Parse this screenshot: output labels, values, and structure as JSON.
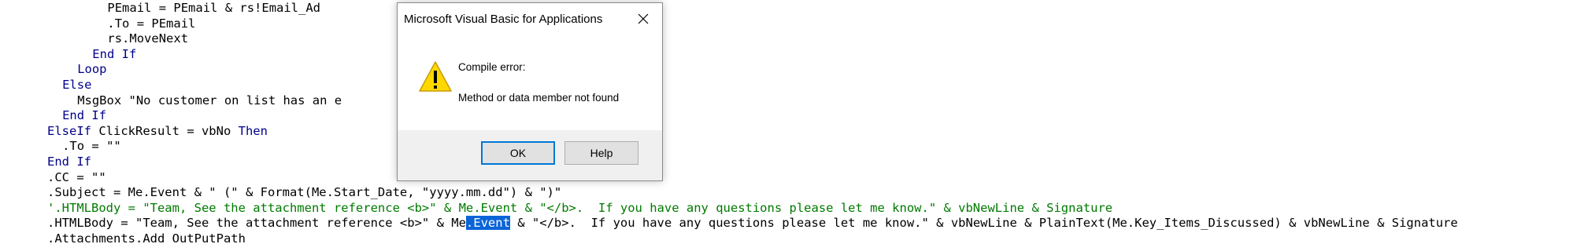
{
  "code_lines": [
    {
      "indent": "                ",
      "segments": [
        {
          "text": "PEmail = PEmail & rs!Email_Ad                  \"",
          "cls": ""
        }
      ]
    },
    {
      "indent": "                ",
      "segments": [
        {
          "text": ".To = PEmail",
          "cls": ""
        }
      ]
    },
    {
      "indent": "                ",
      "segments": [
        {
          "text": "rs.MoveNext",
          "cls": ""
        }
      ]
    },
    {
      "indent": "            ",
      "segments": [
        {
          "text": "End If",
          "cls": "kw"
        }
      ]
    },
    {
      "indent": "        ",
      "segments": [
        {
          "text": "Loop",
          "cls": "kw"
        }
      ]
    },
    {
      "indent": "    ",
      "segments": [
        {
          "text": "Else",
          "cls": "kw"
        }
      ]
    },
    {
      "indent": "        ",
      "segments": [
        {
          "text": "MsgBox \"No customer on list has an e",
          "cls": ""
        }
      ]
    },
    {
      "indent": "    ",
      "segments": [
        {
          "text": "End If",
          "cls": "kw"
        }
      ]
    },
    {
      "indent": "",
      "segments": [
        {
          "text": "ElseIf",
          "cls": "kw"
        },
        {
          "text": " ClickResult = vbNo ",
          "cls": ""
        },
        {
          "text": "Then",
          "cls": "kw"
        }
      ]
    },
    {
      "indent": "    ",
      "segments": [
        {
          "text": ".To = \"\"",
          "cls": ""
        }
      ]
    },
    {
      "indent": "",
      "segments": [
        {
          "text": "End If",
          "cls": "kw"
        }
      ]
    },
    {
      "indent": "",
      "segments": [
        {
          "text": ".CC = \"\"",
          "cls": ""
        }
      ]
    },
    {
      "indent": "",
      "segments": [
        {
          "text": ".Subject = Me.Event & \" (\" & Format(Me.Start_Date, \"yyyy.mm.dd\") & \")\"",
          "cls": ""
        }
      ]
    },
    {
      "indent": "",
      "segments": [
        {
          "text": "'.HTMLBody = \"Team, See the attachment reference <b>\" & Me.Event & \"</b>.  If you have any questions please let me know.\" & vbNewLine & Signature",
          "cls": "cm"
        }
      ]
    },
    {
      "indent": "",
      "segments": [
        {
          "text": ".HTMLBody = \"Team, See the attachment reference <b>\" & Me",
          "cls": ""
        },
        {
          "text": ".Event",
          "cls": "sel"
        },
        {
          "text": " & \"</b>.  If you have any questions please let me know.\" & vbNewLine & PlainText(Me.Key_Items_Discussed) & vbNewLine & Signature",
          "cls": ""
        }
      ]
    },
    {
      "indent": "",
      "segments": [
        {
          "text": ".Attachments.Add OutPutPath",
          "cls": ""
        }
      ]
    }
  ],
  "colors": {
    "keyword": "#00008b",
    "comment": "#007a00",
    "selection": "#0a64d8"
  },
  "dialog": {
    "title": "Microsoft Visual Basic for Applications",
    "close_icon": "close-icon",
    "warning_icon": "warning-icon",
    "message_heading": "Compile error:",
    "message_detail": "Method or data member not found",
    "ok_label": "OK",
    "help_label": "Help"
  }
}
